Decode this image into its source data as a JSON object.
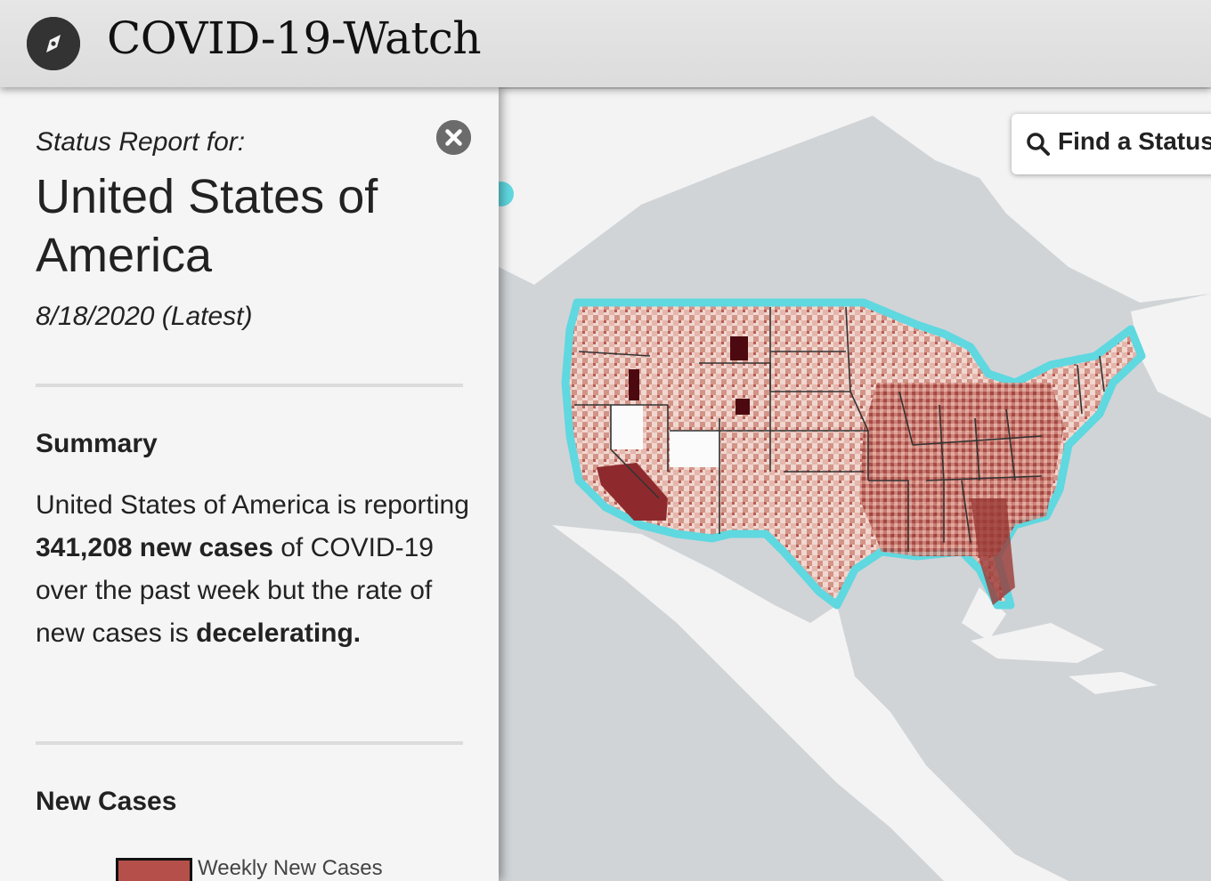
{
  "header": {
    "title": "COVID-19-Watch",
    "logo_icon": "compass-icon"
  },
  "search": {
    "label": "Find a Status",
    "icon": "search-icon"
  },
  "report": {
    "prefix": "Status Report for:",
    "region": "United States of America",
    "date": "8/18/2020 (Latest)"
  },
  "summary": {
    "heading": "Summary",
    "text_1": "United States of America is reporting ",
    "new_cases_strong": "341,208 new cases",
    "text_2": " of COVID-19 over the past week but the rate of new cases is ",
    "trend_strong": "decelerating."
  },
  "new_cases": {
    "heading": "New Cases",
    "legend_label": "Weekly New Cases"
  },
  "colors": {
    "highlight_outline": "#5fd8e0",
    "choropleth_light": "#f2ddd6",
    "choropleth_mid": "#c97b72",
    "choropleth_dark": "#5e0a12",
    "legend_fill": "#b54f4a"
  }
}
